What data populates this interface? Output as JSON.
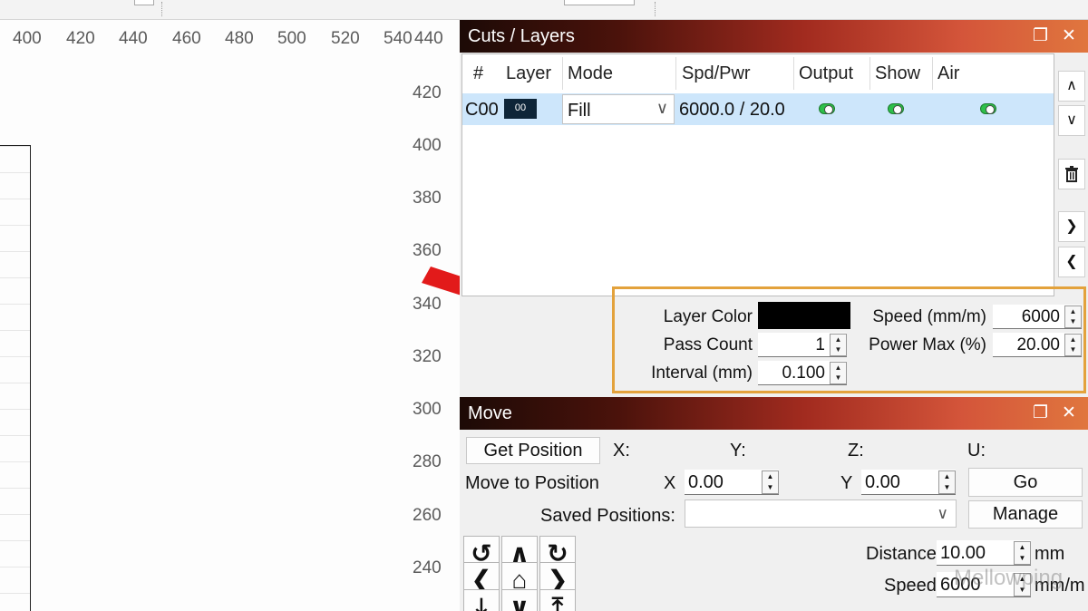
{
  "canvas": {
    "x_ticks": [
      "400",
      "420",
      "440",
      "460",
      "480",
      "500",
      "520",
      "540",
      "440"
    ],
    "y_ticks": [
      "420",
      "400",
      "380",
      "360",
      "340",
      "320",
      "300",
      "280",
      "260",
      "240"
    ]
  },
  "cuts_panel": {
    "title": "Cuts / Layers",
    "columns": [
      "#",
      "Layer",
      "Mode",
      "Spd/Pwr",
      "Output",
      "Show",
      "Air"
    ],
    "rows": [
      {
        "id": "C00",
        "layer": "00",
        "mode": "Fill",
        "spd_pwr": "6000.0 / 20.0",
        "output": true,
        "show": true,
        "air": true
      }
    ],
    "side_buttons": [
      "move-up",
      "move-down",
      "delete",
      "next",
      "prev"
    ],
    "properties": {
      "layer_color_label": "Layer Color",
      "layer_color": "#000000",
      "pass_count_label": "Pass Count",
      "pass_count": "1",
      "interval_label": "Interval (mm)",
      "interval": "0.100",
      "speed_label": "Speed (mm/m)",
      "speed": "6000",
      "power_max_label": "Power Max (%)",
      "power_max": "20.00"
    }
  },
  "move_panel": {
    "title": "Move",
    "get_position_label": "Get Position",
    "axes": [
      "X:",
      "Y:",
      "Z:",
      "U:"
    ],
    "move_to_label": "Move to Position",
    "x_label": "X",
    "x_value": "0.00",
    "y_label": "Y",
    "y_value": "0.00",
    "go_label": "Go",
    "saved_positions_label": "Saved Positions:",
    "manage_label": "Manage",
    "distance_label": "Distance",
    "distance_value": "10.00",
    "distance_unit": "mm",
    "speed_label": "Speed",
    "speed_value": "6000",
    "speed_unit": "mm/m",
    "watermark": "Mellowping"
  },
  "colors": {
    "selection_row": "#cde6fb",
    "highlight_box": "#e3a23c",
    "toggle_on": "#2ec04a",
    "arrow": "#e21a1a"
  }
}
